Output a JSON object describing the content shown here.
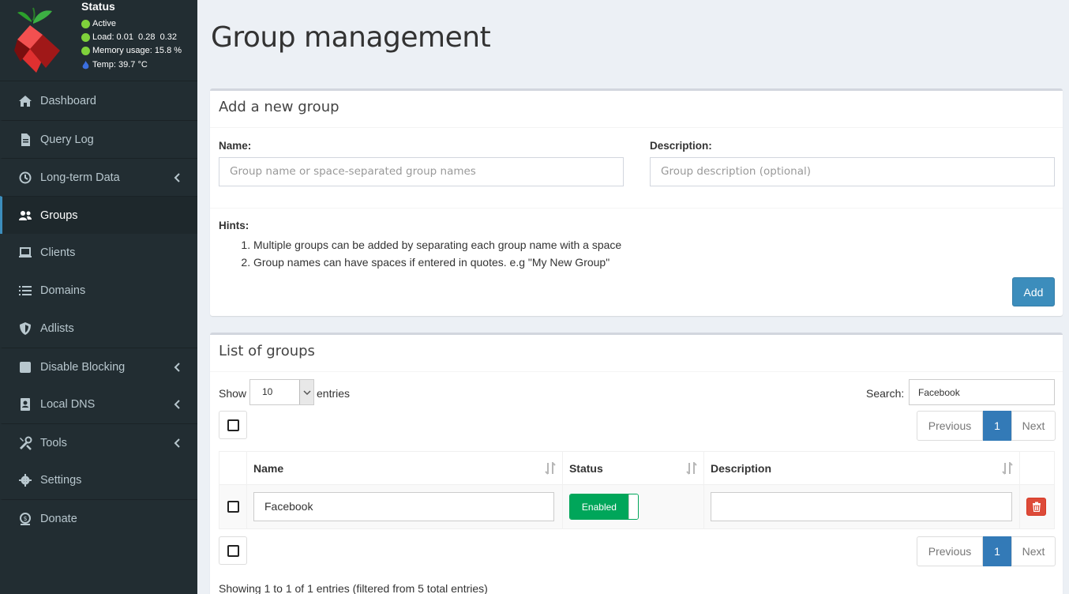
{
  "status": {
    "title": "Status",
    "active": "Active",
    "load_label": "Load:",
    "load_values": "0.01  0.28  0.32",
    "memory_label": "Memory usage:",
    "memory_value": "15.8 %",
    "temp": "Temp: 39.7 °C"
  },
  "menu": {
    "dashboard": "Dashboard",
    "query_log": "Query Log",
    "long_term": "Long-term Data",
    "groups": "Groups",
    "clients": "Clients",
    "domains": "Domains",
    "adlists": "Adlists",
    "disable_blocking": "Disable Blocking",
    "local_dns": "Local DNS",
    "tools": "Tools",
    "settings": "Settings",
    "donate": "Donate"
  },
  "page": {
    "title": "Group management"
  },
  "add_group": {
    "header": "Add a new group",
    "name_label": "Name:",
    "name_placeholder": "Group name or space-separated group names",
    "desc_label": "Description:",
    "desc_placeholder": "Group description (optional)",
    "hints_label": "Hints:",
    "hints": [
      "Multiple groups can be added by separating each group name with a space",
      "Group names can have spaces if entered in quotes. e.g \"My New Group\""
    ],
    "add_button": "Add"
  },
  "list": {
    "header": "List of groups",
    "show_label": "Show",
    "entries_select": "10",
    "entries_label": "entries",
    "search_label": "Search:",
    "search_value": "Facebook",
    "pager": {
      "previous": "Previous",
      "page": "1",
      "next": "Next"
    },
    "columns": {
      "name": "Name",
      "status": "Status",
      "description": "Description"
    },
    "rows": [
      {
        "name": "Facebook",
        "status": "Enabled",
        "description": ""
      }
    ],
    "footer": "Showing 1 to 1 of 1 entries (filtered from 5 total entries)"
  },
  "colors": {
    "sidebar": "#222d32",
    "accent": "#3c8dbc",
    "enabled": "#00a65a",
    "danger": "#dd4b39"
  }
}
